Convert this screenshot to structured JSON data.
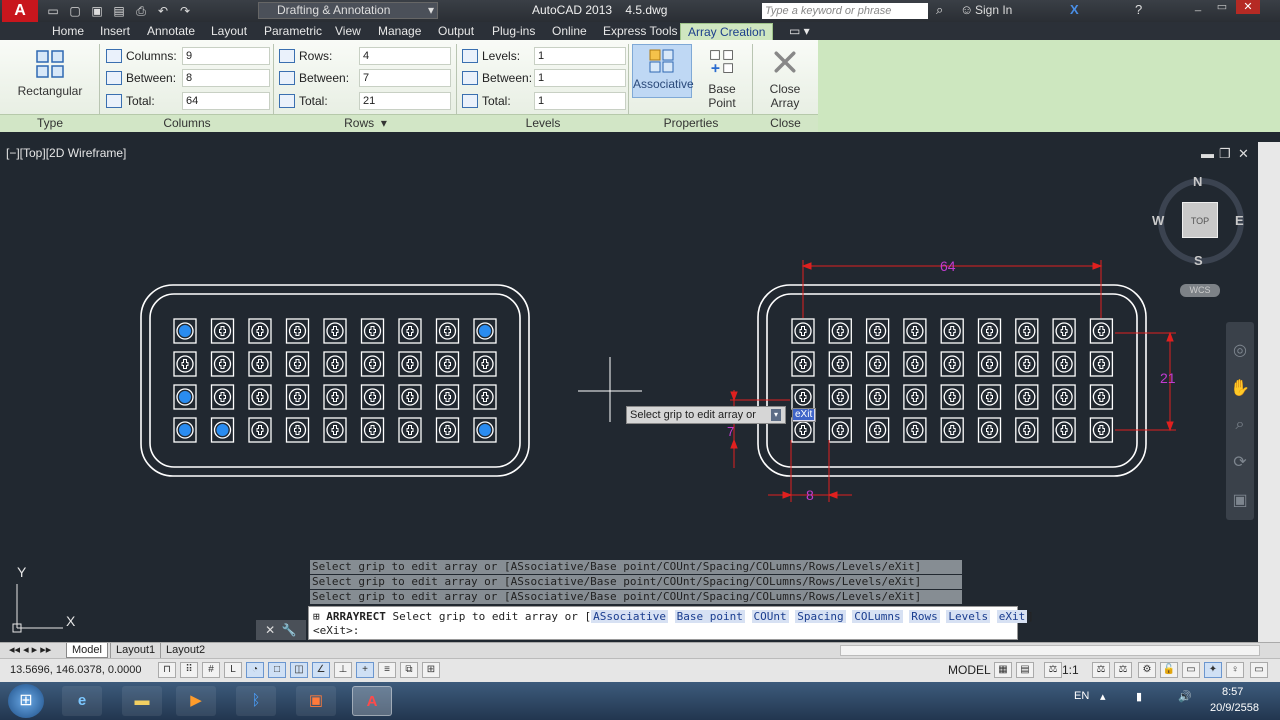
{
  "title_bar": {
    "app_title": "AutoCAD 2013",
    "file_name": "4.5.dwg",
    "workspace": "Drafting & Annotation",
    "search_placeholder": "Type a keyword or phrase",
    "sign_in": "Sign In"
  },
  "ribbon_tabs": [
    "Home",
    "Insert",
    "Annotate",
    "Layout",
    "Parametric",
    "View",
    "Manage",
    "Output",
    "Plug-ins",
    "Online",
    "Express Tools",
    "Array Creation"
  ],
  "ribbon": {
    "type_panel": {
      "button": "Rectangular",
      "footer": "Type"
    },
    "columns_panel": {
      "footer": "Columns",
      "fields": [
        {
          "label": "Columns:",
          "value": "9"
        },
        {
          "label": "Between:",
          "value": "8"
        },
        {
          "label": "Total:",
          "value": "64"
        }
      ]
    },
    "rows_panel": {
      "footer": "Rows",
      "fields": [
        {
          "label": "Rows:",
          "value": "4"
        },
        {
          "label": "Between:",
          "value": "7"
        },
        {
          "label": "Total:",
          "value": "21"
        }
      ]
    },
    "levels_panel": {
      "footer": "Levels",
      "fields": [
        {
          "label": "Levels:",
          "value": "1"
        },
        {
          "label": "Between:",
          "value": "1"
        },
        {
          "label": "Total:",
          "value": "1"
        }
      ]
    },
    "properties_panel": {
      "associative": "Associative",
      "base_point": "Base Point",
      "footer": "Properties"
    },
    "close_panel": {
      "close_array": "Close Array",
      "footer": "Close"
    }
  },
  "viewport": {
    "label": "[−][Top][2D Wireframe]",
    "viewcube_top": "TOP",
    "compass": {
      "n": "N",
      "s": "S",
      "e": "E",
      "w": "W"
    },
    "wcs": "WCS",
    "dimensions": {
      "total_width": "64",
      "total_height": "21",
      "spacing": "8",
      "row_spacing": "7"
    },
    "tooltip": "Select grip to edit array or",
    "tooltip_input": "eXit"
  },
  "command": {
    "history": [
      "Select grip to edit array or [ASsociative/Base point/COUnt/Spacing/COLumns/Rows/Levels/eXit]<eXit>:",
      "Select grip to edit array or [ASsociative/Base point/COUnt/Spacing/COLumns/Rows/Levels/eXit]<eXit>:",
      "Select grip to edit array or [ASsociative/Base point/COUnt/Spacing/COLumns/Rows/Levels/eXit]<eXit>:"
    ],
    "command_name": "ARRAYRECT",
    "prompt": "Select grip to edit array or [",
    "options": [
      "ASsociative",
      "Base point",
      "COUnt",
      "Spacing",
      "COLumns",
      "Rows",
      "Levels",
      "eXit"
    ],
    "prompt_end": "]",
    "default": "<eXit>:"
  },
  "layout_tabs": [
    "Model",
    "Layout1",
    "Layout2"
  ],
  "status": {
    "coordinates": "13.5696, 146.0378, 0.0000",
    "model": "MODEL",
    "scale": "1:1"
  },
  "taskbar": {
    "language": "EN",
    "time": "8:57",
    "date": "20/9/2558"
  },
  "colors": {
    "viewport_bg": "#212830",
    "dimension": "#e0201f",
    "dimension_text": "#c23bd0",
    "grip": "#2a8cf0",
    "ribbon_active_tab": "#cfe6c0"
  }
}
